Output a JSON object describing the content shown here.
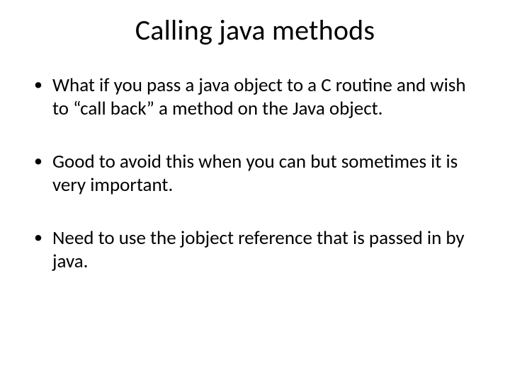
{
  "slide": {
    "title": "Calling java methods",
    "bullets": [
      "What if you pass a java object to a C routine and wish to “call back” a method on the Java object.",
      "Good to avoid this when you can but sometimes it is very important.",
      "Need to use the jobject reference that is passed in by java."
    ]
  }
}
